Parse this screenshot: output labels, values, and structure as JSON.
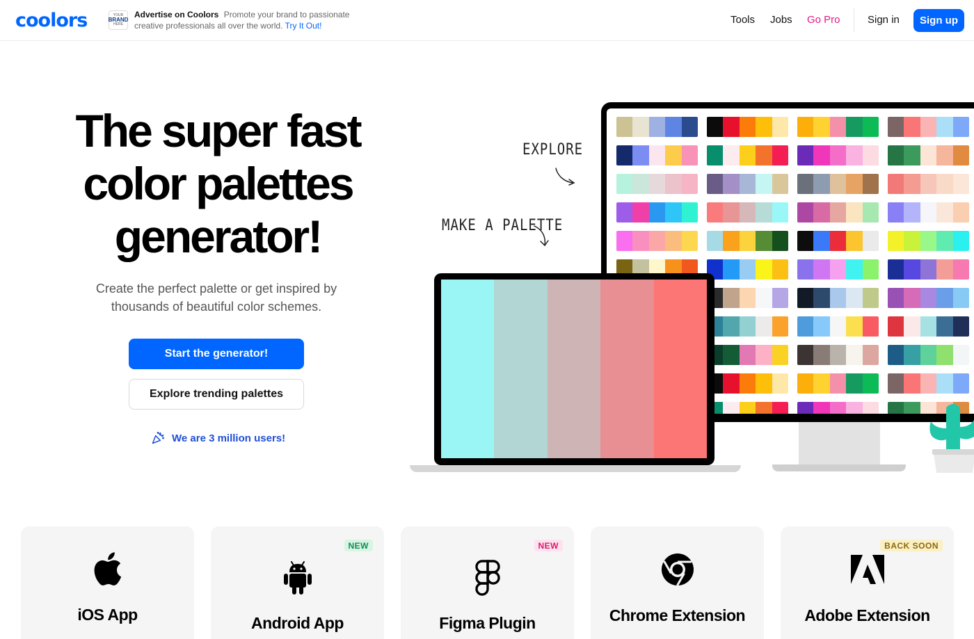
{
  "header": {
    "logo": "coolors",
    "ad": {
      "badge_top": "YOUR",
      "badge_mid": "BRAND",
      "badge_bottom": "HERE",
      "title": "Advertise on Coolors",
      "text": "Promote your brand to passionate creative professionals all over the world.",
      "link": "Try It Out!"
    },
    "nav": {
      "tools": "Tools",
      "jobs": "Jobs",
      "pro": "Go Pro",
      "signin": "Sign in",
      "signup": "Sign up"
    },
    "pro_color": "#e6198a",
    "accent": "#0066ff"
  },
  "hero": {
    "title_line1": "The super fast",
    "title_line2": "color palettes",
    "title_line3": "generator!",
    "subtitle": "Create the perfect palette or get inspired by thousands of beautiful color schemes.",
    "cta_primary": "Start the generator!",
    "cta_secondary": "Explore trending palettes",
    "users": "We are 3 million users!"
  },
  "illustration": {
    "label_explore": "EXPLORE",
    "label_make": "MAKE A PALETTE",
    "laptop_palette": [
      "#9af6f4",
      "#b1d6d4",
      "#cfb4b6",
      "#e78f92",
      "#fd7676"
    ],
    "monitor_palettes": [
      [
        [
          "#cdc293",
          "#e9e3d1",
          "#9fb0e3",
          "#5f85e4",
          "#2b4b8f"
        ],
        [
          "#0b0b0b",
          "#e8112d",
          "#fb7c0a",
          "#fdbf0a",
          "#fde8a9"
        ],
        [
          "#fcae0a",
          "#fdd231",
          "#f490a9",
          "#159a5f",
          "#0cbb55"
        ],
        [
          "#7c6665",
          "#fa7575",
          "#fbb4b4",
          "#abdff8",
          "#7ea8f8"
        ]
      ],
      [
        [
          "#142a6b",
          "#7b8cf3",
          "#fbe6f0",
          "#fccc4a",
          "#f892b6"
        ],
        [
          "#078e6c",
          "#fcecf0",
          "#fccf1b",
          "#f3722c",
          "#f41e55"
        ],
        [
          "#6c2ab8",
          "#f036b9",
          "#f46dc9",
          "#fab2e1",
          "#fcdbe2"
        ],
        [
          "#257545",
          "#3b9a5c",
          "#fce4d6",
          "#f6b69c",
          "#e08b3f"
        ]
      ],
      [
        [
          "#b6f2dd",
          "#cbe6da",
          "#e6d9dc",
          "#ecc2cb",
          "#f6b4c4"
        ],
        [
          "#695c86",
          "#a490c7",
          "#a8b7d7",
          "#c5f6f3",
          "#d9c79b"
        ],
        [
          "#6a717b",
          "#8d9cb0",
          "#dfc29b",
          "#e6a363",
          "#a0734c"
        ],
        [
          "#f17a79",
          "#f49b92",
          "#f7c6bb",
          "#f9dac8",
          "#fbe6d7"
        ]
      ],
      [
        [
          "#9e5de9",
          "#f13fa9",
          "#2a97f0",
          "#2ec5f8",
          "#2ef2d1"
        ],
        [
          "#fa7b7b",
          "#e89595",
          "#d6b8ba",
          "#b7dcd8",
          "#9af7f7"
        ],
        [
          "#ac48a3",
          "#d86aa5",
          "#e6a7a1",
          "#fbe5c1",
          "#a6e8b0"
        ],
        [
          "#8a80f5",
          "#b3b4fa",
          "#f5f5fa",
          "#fbe6da",
          "#faceb0"
        ]
      ],
      [
        [
          "#fa6ff0",
          "#f98fbf",
          "#fba7a7",
          "#fbbd7d",
          "#fcd74f"
        ],
        [
          "#a6dbe6",
          "#faa21b",
          "#fcd23d",
          "#558c34",
          "#154f1c"
        ],
        [
          "#0d0d0d",
          "#3a7af9",
          "#eb2d3b",
          "#fcc42f",
          "#eaeaea"
        ],
        [
          "#f3f129",
          "#c9f33a",
          "#99f88a",
          "#60ebb1",
          "#2af0f0"
        ]
      ],
      [
        [
          "#7a6312",
          "#c3c19e",
          "#fff7cc",
          "#f8901c",
          "#f0581d"
        ],
        [
          "#1131cc",
          "#239bf6",
          "#98ccf3",
          "#faf41b",
          "#fcc014"
        ],
        [
          "#8a72ec",
          "#cf77f2",
          "#f6a1f0",
          "#40f3f0",
          "#8af36b"
        ],
        [
          "#1b2e95",
          "#5848e2",
          "#8d74d6",
          "#f39c98",
          "#f679b0"
        ]
      ],
      [
        [
          "#2a2a2a",
          "#c0a48c",
          "#fbd6b0",
          "#f5f7f9",
          "#b5a6e6"
        ],
        [
          "#2a2a2a",
          "#c0a48c",
          "#fbd6b0",
          "#f5f7f9",
          "#b5a6e6"
        ],
        [
          "#111a26",
          "#2d4a6c",
          "#a9c8ec",
          "#dbe8f4",
          "#bfc98a"
        ],
        [
          "#9a51b5",
          "#d66bb7",
          "#a888e0",
          "#6b9ee8",
          "#87cbf5"
        ]
      ],
      [
        [
          "#2d8199",
          "#52a7ac",
          "#93d0d2",
          "#ebebeb",
          "#fba22d"
        ],
        [
          "#2d8199",
          "#52a7ac",
          "#93d0d2",
          "#ebebeb",
          "#fba22d"
        ],
        [
          "#4e9cdc",
          "#87c9fa",
          "#f6f6f6",
          "#fcdf4f",
          "#f95b62"
        ],
        [
          "#de3541",
          "#fbe9ea",
          "#a6e2e4",
          "#3c6e95",
          "#1f2f57"
        ]
      ],
      [
        [
          "#0a3d2a",
          "#145c35",
          "#e279b4",
          "#fcb1c6",
          "#f9d223"
        ],
        [
          "#0a3d2a",
          "#145c35",
          "#e279b4",
          "#fcb1c6",
          "#f9d223"
        ],
        [
          "#3c3433",
          "#897c77",
          "#bab3ac",
          "#f6f4ec",
          "#dba7a0"
        ],
        [
          "#1e5c88",
          "#36a0a4",
          "#5ed29a",
          "#90e06f",
          "#f2f6f7"
        ]
      ],
      [
        [
          "#0b0b0b",
          "#e8112d",
          "#fb7c0a",
          "#fdbf0a",
          "#fde8a9"
        ],
        [
          "#0b0b0b",
          "#e8112d",
          "#fb7c0a",
          "#fdbf0a",
          "#fde8a9"
        ],
        [
          "#fcae0a",
          "#fdd231",
          "#f490a9",
          "#159a5f",
          "#0cbb55"
        ],
        [
          "#7c6665",
          "#fa7575",
          "#fbb4b4",
          "#abdff8",
          "#7ea8f8"
        ]
      ],
      [
        [
          "#078e6c",
          "#fcecf0",
          "#fccf1b",
          "#f3722c",
          "#f41e55"
        ],
        [
          "#078e6c",
          "#fcecf0",
          "#fccf1b",
          "#f3722c",
          "#f41e55"
        ],
        [
          "#6c2ab8",
          "#f036b9",
          "#f46dc9",
          "#fab2e1",
          "#fcdbe2"
        ],
        [
          "#257545",
          "#3b9a5c",
          "#fce4d6",
          "#f6b69c",
          "#e08b3f"
        ]
      ]
    ]
  },
  "cards": [
    {
      "label": "iOS App",
      "badge": "",
      "icon": "apple-icon"
    },
    {
      "label": "Android App",
      "badge": "NEW",
      "icon": "android-icon"
    },
    {
      "label": "Figma Plugin",
      "badge": "NEW",
      "icon": "figma-icon"
    },
    {
      "label": "Chrome Extension",
      "badge": "",
      "icon": "chrome-icon"
    },
    {
      "label": "Adobe Extension",
      "badge": "BACK SOON",
      "icon": "adobe-icon"
    }
  ]
}
